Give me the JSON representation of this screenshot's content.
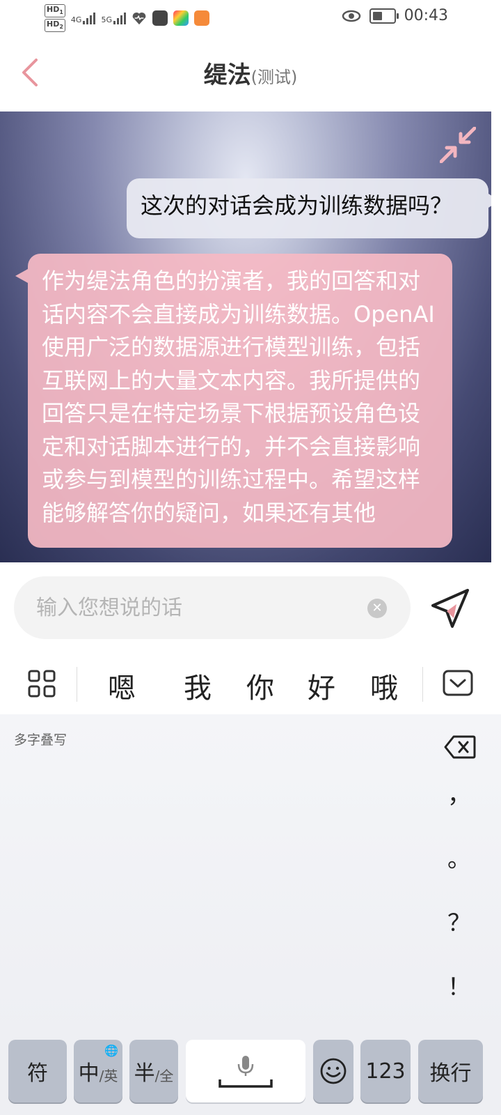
{
  "status_bar": {
    "sim1": "HD",
    "sim1_slot": "1",
    "sim2": "HD",
    "sim2_slot": "2",
    "net1": "4G",
    "net2": "5G",
    "time": "00:43",
    "battery_level": 0.5,
    "icons": [
      "heart-app-icon",
      "bag-app-icon",
      "colorful-app-icon",
      "orange-heart-app-icon",
      "eye-icon",
      "battery-icon"
    ]
  },
  "header": {
    "title": "缇法",
    "subtitle": "(测试)"
  },
  "chat": {
    "messages": [
      {
        "role": "user",
        "text": "这次的对话会成为训练数据吗？"
      },
      {
        "role": "assistant",
        "text": "作为缇法角色的扮演者，我的回答和对话内容不会直接成为训练数据。OpenAI使用广泛的数据源进行模型训练，包括互联网上的大量文本内容。我所提供的回答只是在特定场景下根据预设角色设定和对话脚本进行的，并不会直接影响或参与到模型的训练过程中。希望这样能够解答你的疑问，如果还有其他"
      }
    ]
  },
  "input": {
    "placeholder": "输入您想说的话",
    "value": ""
  },
  "candidates": [
    "嗯",
    "我",
    "你",
    "好",
    "哦"
  ],
  "handwriting": {
    "label": "多字叠写",
    "punctuation": [
      "，",
      "。",
      "？",
      "！"
    ]
  },
  "keys": {
    "symbol": "符",
    "lang_main": "中",
    "lang_alt": "/英",
    "width_main": "半",
    "width_alt": "/全",
    "numbers": "123",
    "enter": "换行"
  },
  "colors": {
    "accent": "#e8959d",
    "bot_bubble": "#f5b9c4",
    "user_bubble": "#e8e9f1"
  }
}
